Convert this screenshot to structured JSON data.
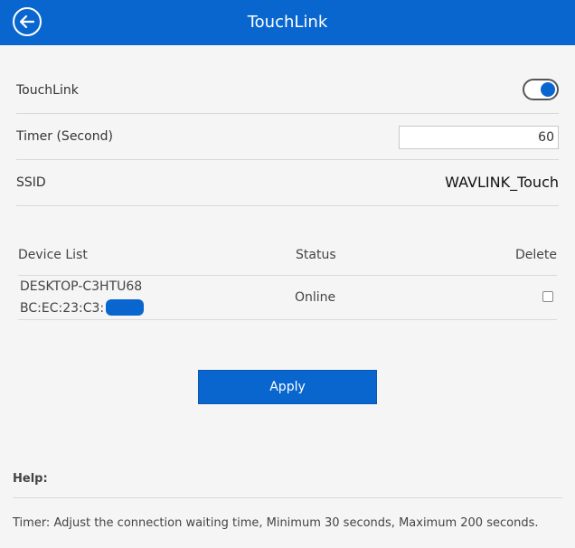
{
  "header": {
    "title": "TouchLink",
    "back_icon": "arrow-left-circle-icon"
  },
  "settings": {
    "touchlink_label": "TouchLink",
    "touchlink_enabled": true,
    "timer_label": "Timer (Second)",
    "timer_value": "60",
    "ssid_label": "SSID",
    "ssid_value": "WAVLINK_Touch"
  },
  "device_table": {
    "headers": {
      "device": "Device List",
      "status": "Status",
      "delete": "Delete"
    },
    "rows": [
      {
        "name": "DESKTOP-C3HTU68",
        "mac": "BC:EC:23:C3:",
        "status": "Online",
        "delete_checked": false
      }
    ]
  },
  "apply_label": "Apply",
  "help": {
    "title": "Help:",
    "text": "Timer: Adjust the connection waiting time, Minimum 30 seconds, Maximum 200 seconds."
  },
  "colors": {
    "accent": "#0a66cf",
    "background": "#f5f5f5",
    "divider": "#d9d9d9"
  }
}
